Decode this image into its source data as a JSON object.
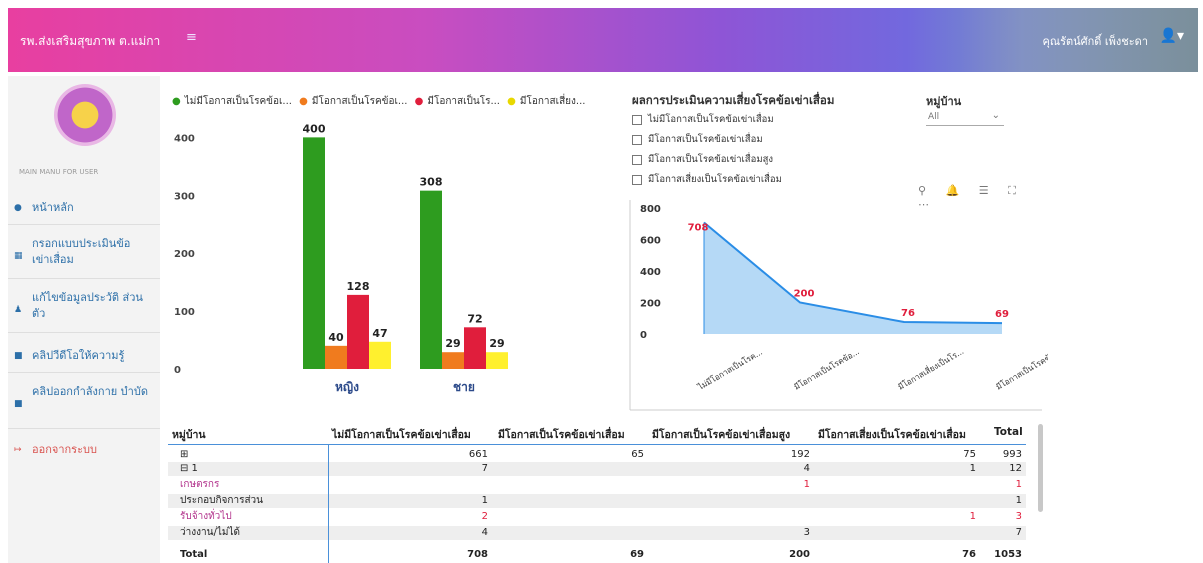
{
  "header": {
    "title": "รพ.ส่งเสริมสุขภาพ ต.แม่กา",
    "menu_glyph": "≡",
    "user_name": "คุณรัตน์ศักดิ์ เพ็งชะดา",
    "user_glyph": "👤▾"
  },
  "sidebar": {
    "caption": "MAIN MANU FOR USER",
    "items": [
      {
        "label": "หน้าหลัก",
        "glyph": "●"
      },
      {
        "label": "กรอกแบบประเมินข้อ เข่าเสื่อม",
        "glyph": "▦"
      },
      {
        "label": "แก้ไขข้อมูลประวัติ ส่วนตัว",
        "glyph": "♟"
      },
      {
        "label": "คลิปวีดีโอให้ความรู้",
        "glyph": "■"
      },
      {
        "label": "คลิปออกกำลังกาย บำบัด",
        "glyph": "■"
      },
      {
        "label": "ออกจากระบบ",
        "glyph": "↦"
      }
    ]
  },
  "colors": {
    "green": "#2e9c1f",
    "orange": "#f07b1e",
    "red": "#e01e3c",
    "yellow": "#fff02e",
    "area_fill": "#a8d2f5",
    "area_line": "#2a8de6"
  },
  "chart_data": [
    {
      "type": "bar",
      "categories": [
        "หญิง",
        "ชาย"
      ],
      "series": [
        {
          "name": "ไม่มีโอกาสเป็นโรคข้อเ...",
          "color": "#2e9c1f",
          "values": [
            400,
            308
          ]
        },
        {
          "name": "มีโอกาสเป็นโรคข้อเ...",
          "color": "#f07b1e",
          "values": [
            40,
            29
          ]
        },
        {
          "name": "มีโอกาสเป็นโร...",
          "color": "#e01e3c",
          "values": [
            128,
            72
          ]
        },
        {
          "name": "มีโอกาสเสี่ยง...",
          "color": "#fff02e",
          "values": [
            47,
            29
          ]
        }
      ],
      "yticks": [
        0,
        100,
        200,
        300,
        400
      ],
      "ylim": [
        0,
        430
      ]
    },
    {
      "type": "area",
      "title": "ผลการประเมินความเสี่ยงโรคข้อเข่าเสื่อม",
      "categories": [
        "ไม่มีโอกาสเป็นโรค...",
        "มีโอกาสเป็นโรคข้อ...",
        "มีโอกาสเสี่ยงเป็นโร...",
        "มีโอกาสเป็นโรคข้อ..."
      ],
      "values": [
        708,
        200,
        76,
        69
      ],
      "yticks": [
        0,
        200,
        400,
        600,
        800
      ],
      "ylim": [
        0,
        800
      ]
    }
  ],
  "filter": {
    "options": [
      "ไม่มีโอกาสเป็นโรคข้อเข่าเสื่อม",
      "มีโอกาสเป็นโรคข้อเข่าเสื่อม",
      "มีโอกาสเป็นโรคข้อเข่าเสื่อมสูง",
      "มีโอกาสเสี่ยงเป็นโรคข้อเข่าเสื่อม"
    ],
    "village_label": "หมู่บ้าน",
    "village_value": "All",
    "toolbar_glyphs": "⚲ 🔔 ☰ ⛶ ⋯"
  },
  "table": {
    "headers": [
      "หมู่บ้าน",
      "ไม่มีโอกาสเป็นโรคข้อเข่าเสื่อม",
      "มีโอกาสเป็นโรคข้อเข่าเสื่อม",
      "มีโอกาสเป็นโรคข้อเข่าเสื่อมสูง",
      "มีโอกาสเสี่ยงเป็นโรคข้อเข่าเสื่อม",
      "Total"
    ],
    "rows": [
      {
        "label": "⊞",
        "c1": "661",
        "c2": "65",
        "c3": "192",
        "c4": "75",
        "total": "993"
      },
      {
        "label": "⊟ 1",
        "c1": "7",
        "c2": "",
        "c3": "4",
        "c4": "1",
        "total": "12"
      },
      {
        "label": "เกษตรกร",
        "c1": "",
        "c2": "",
        "c3": "1",
        "c4": "",
        "total": "1"
      },
      {
        "label": "ประกอบกิจการส่วน",
        "c1": "1",
        "c2": "",
        "c3": "",
        "c4": "",
        "total": "1"
      },
      {
        "label": "รับจ้างทั่วไป",
        "c1": "2",
        "c2": "",
        "c3": "",
        "c4": "1",
        "total": "3"
      },
      {
        "label": "ว่างงาน/ไม่ได้",
        "c1": "4",
        "c2": "",
        "c3": "3",
        "c4": "",
        "total": "7"
      }
    ],
    "total_row": {
      "label": "Total",
      "c1": "708",
      "c2": "69",
      "c3": "200",
      "c4": "76",
      "total": "1053"
    }
  }
}
